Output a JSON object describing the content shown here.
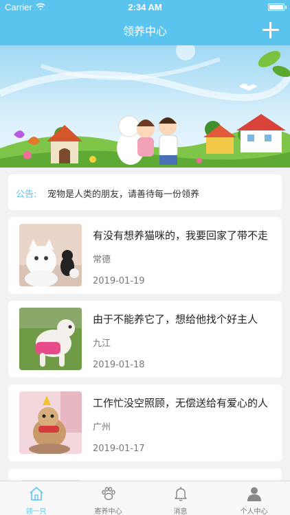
{
  "status_bar": {
    "carrier": "Carrier",
    "time": "2:34 AM"
  },
  "nav": {
    "title": "领养中心",
    "add_icon": "plus-icon"
  },
  "banner": {
    "image": "cartoon-family-with-pets-banner"
  },
  "notice": {
    "label": "公告:",
    "text": "宠物是人类的朋友，请善待每一份领养"
  },
  "posts": [
    {
      "title": "有没有想养猫咪的，我要回家了带不走",
      "city": "常德",
      "date": "2019-01-19",
      "thumb": "white-cat-photo"
    },
    {
      "title": "由于不能养它了，想给他找个好主人",
      "city": "九江",
      "date": "2019-01-18",
      "thumb": "white-poodle-photo"
    },
    {
      "title": "工作忙没空照顾，无偿送给有爱心的人",
      "city": "广州",
      "date": "2019-01-17",
      "thumb": "yorkie-dog-photo"
    }
  ],
  "tabbar": {
    "tabs": [
      {
        "label": "领一只",
        "icon": "home-icon",
        "active": true
      },
      {
        "label": "寄养中心",
        "icon": "paw-icon",
        "active": false
      },
      {
        "label": "消息",
        "icon": "bell-icon",
        "active": false
      },
      {
        "label": "个人中心",
        "icon": "person-icon",
        "active": false
      }
    ]
  },
  "colors": {
    "accent": "#5ac4ef",
    "background": "#f2f2f2"
  }
}
